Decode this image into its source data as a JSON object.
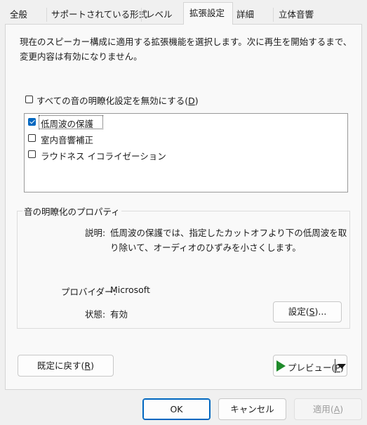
{
  "tabs": [
    {
      "label": "全般"
    },
    {
      "label": "サポートされている形式"
    },
    {
      "label": "レベル"
    },
    {
      "label": "拡張設定"
    },
    {
      "label": "詳細"
    },
    {
      "label": "立体音響"
    }
  ],
  "description": "現在のスピーカー構成に適用する拡張機能を選択します。次に再生を開始するまで、変更内容は有効になりません。",
  "disable_all": {
    "label_pre": "すべての音の明瞭化設定を無効にする(",
    "label_key": "D",
    "label_post": ")",
    "checked": false
  },
  "enhancements": [
    {
      "label": "低周波の保護",
      "checked": true
    },
    {
      "label": "室内音響補正",
      "checked": false
    },
    {
      "label": "ラウドネス イコライゼーション",
      "checked": false
    }
  ],
  "properties": {
    "group_title": "音の明瞭化のプロパティ",
    "desc_label": "説明:",
    "desc_line1": "低周波の保護では、指定したカットオフより下の低周波を取",
    "desc_line2": "り除いて、オーディオのひずみを小さくします。",
    "provider_label": "プロバイダー:",
    "provider_value": "Microsoft",
    "status_label": "状態:",
    "status_value": "有効",
    "settings_pre": "設定(",
    "settings_key": "S",
    "settings_post": ")..."
  },
  "restore": {
    "pre": "既定に戻す(",
    "key": "R",
    "post": ")"
  },
  "preview": {
    "pre": "プレビュー(",
    "key": "P",
    "post": ")"
  },
  "footer": {
    "ok": "OK",
    "cancel": "キャンセル",
    "apply_pre": "適用(",
    "apply_key": "A",
    "apply_post": ")"
  },
  "colors": {
    "accent": "#0067c0",
    "play": "#1e8a2a"
  }
}
